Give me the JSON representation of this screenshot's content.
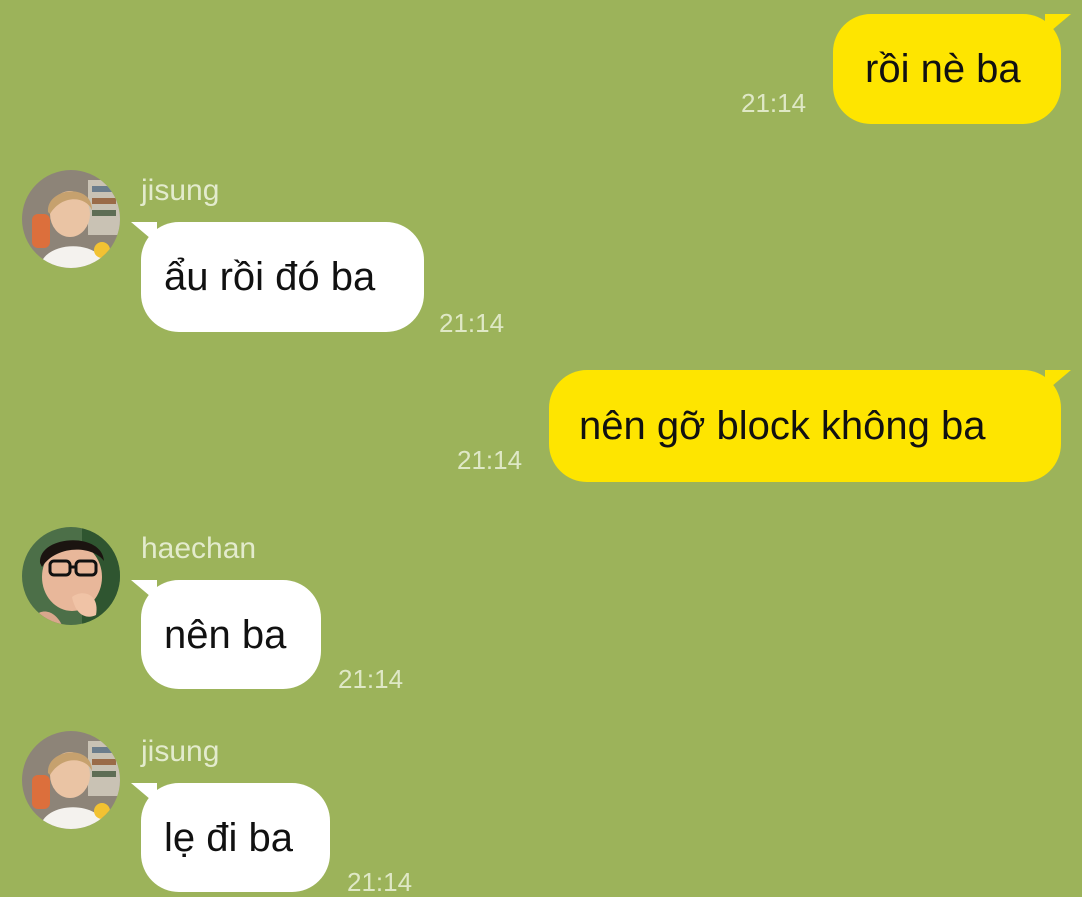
{
  "messages": [
    {
      "direction": "sent",
      "text": "rồi nè ba",
      "time": "21:14"
    },
    {
      "direction": "received",
      "sender": "jisung",
      "avatar": "jisung-avatar",
      "text": "ẩu rồi đó ba",
      "time": "21:14"
    },
    {
      "direction": "sent",
      "text": "nên gỡ block không ba",
      "time": "21:14"
    },
    {
      "direction": "received",
      "sender": "haechan",
      "avatar": "haechan-avatar",
      "text": "nên ba",
      "time": "21:14"
    },
    {
      "direction": "received",
      "sender": "jisung",
      "avatar": "jisung-avatar",
      "text": "lẹ đi ba",
      "time": "21:14"
    }
  ],
  "colors": {
    "background": "#9cb35a",
    "sent_bubble": "#fee500",
    "received_bubble": "#ffffff",
    "timestamp": "#dfe8c6"
  }
}
